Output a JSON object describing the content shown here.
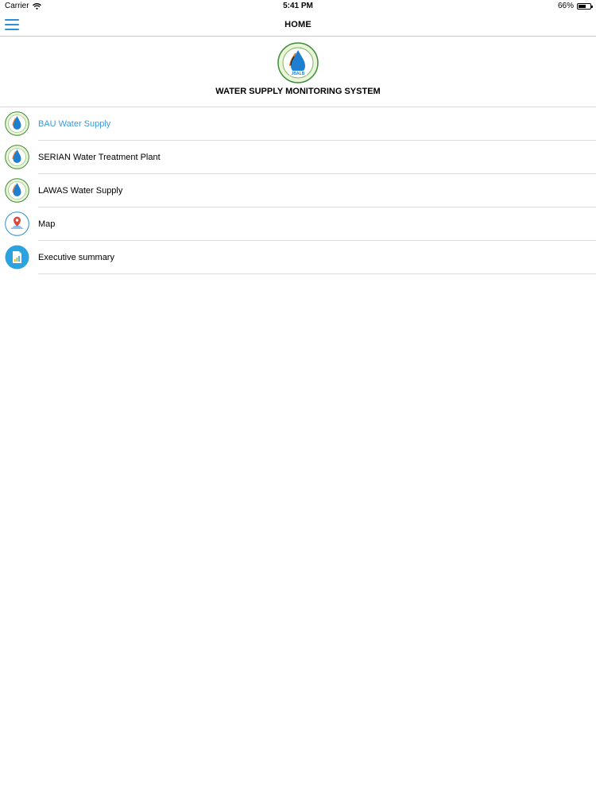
{
  "status_bar": {
    "carrier": "Carrier",
    "time": "5:41 PM",
    "battery_percent": "66%",
    "battery_level": 0.66
  },
  "nav": {
    "title": "HOME",
    "menu_icon": "hamburger-menu-icon",
    "accent_color": "#2a8fd6"
  },
  "header": {
    "logo_text": "JBALB",
    "system_title": "WATER SUPPLY MONITORING SYSTEM"
  },
  "menu_items": [
    {
      "label": "BAU Water Supply",
      "icon": "jbalb-logo-icon",
      "active": true
    },
    {
      "label": "SERIAN Water Treatment Plant",
      "icon": "jbalb-logo-icon",
      "active": false
    },
    {
      "label": "LAWAS Water Supply",
      "icon": "jbalb-logo-icon",
      "active": false
    },
    {
      "label": "Map",
      "icon": "map-pin-icon",
      "active": false
    },
    {
      "label": "Executive summary",
      "icon": "report-document-icon",
      "active": false
    }
  ],
  "colors": {
    "active_text": "#3a9ad9",
    "divider": "#dcdcdf"
  }
}
